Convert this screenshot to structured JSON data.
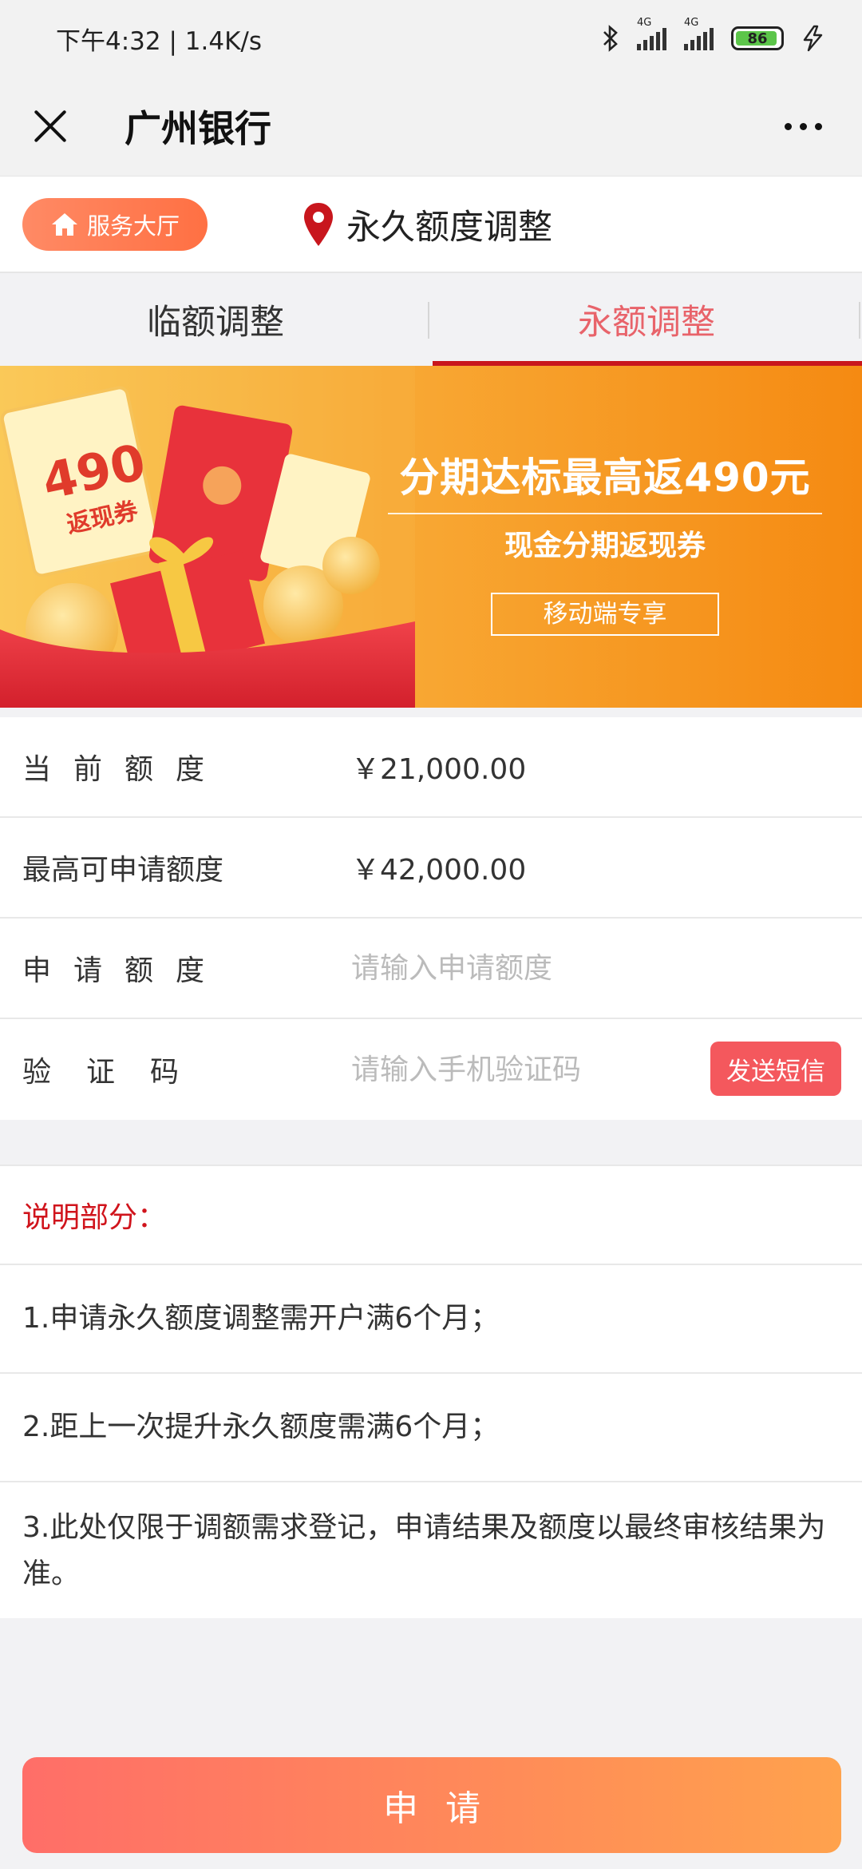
{
  "status_bar": {
    "time_speed": "下午4:32 | 1.4K/s",
    "network_1": "4G",
    "network_2": "4G",
    "battery": "86"
  },
  "title_bar": {
    "title": "广州银行"
  },
  "subheader": {
    "hall_button": "服务大厅",
    "page_title": "永久额度调整"
  },
  "tabs": [
    {
      "label": "临额调整",
      "active": false
    },
    {
      "label": "永额调整",
      "active": true
    }
  ],
  "banner": {
    "coupon_amount": "490",
    "coupon_label": "返现券",
    "headline": "分期达标最高返490元",
    "subline": "现金分期返现券",
    "tag": "移动端专享"
  },
  "form": {
    "current_label": "当前额度",
    "current_value": "￥21,000.00",
    "max_label": "最高可申请额度",
    "max_value": "￥42,000.00",
    "apply_label": "申请额度",
    "apply_placeholder": "请输入申请额度",
    "code_label": "验证码",
    "code_placeholder": "请输入手机验证码",
    "sms_button": "发送短信"
  },
  "notes": {
    "title": "说明部分：",
    "items": [
      "1.申请永久额度调整需开户满6个月；",
      "2.距上一次提升永久额度需满6个月；",
      "3.此处仅限于调额需求登记，申请结果及额度以最终审核结果为准。"
    ]
  },
  "submit_label": "申请",
  "colors": {
    "accent_red": "#c8161d",
    "tab_active": "#e8636a",
    "button_orange": "#ff8a65",
    "note_title": "#d0141c"
  }
}
